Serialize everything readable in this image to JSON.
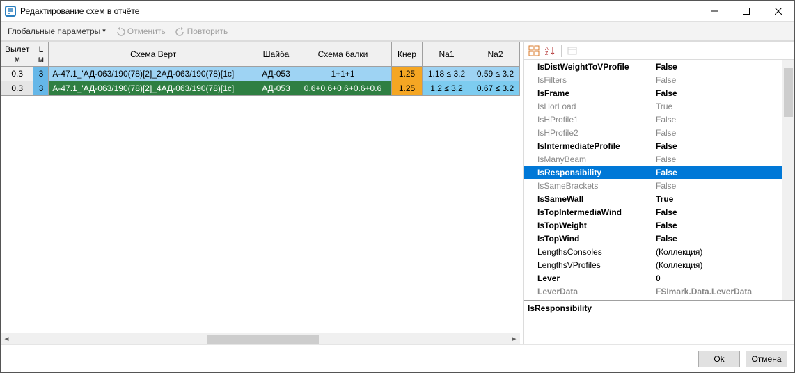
{
  "window": {
    "title": "Редактирование схем в отчёте"
  },
  "toolbar": {
    "global_params": "Глобальные параметры",
    "undo": "Отменить",
    "redo": "Повторить"
  },
  "grid": {
    "headers": {
      "vylet": "Вылет\nм",
      "L": "L\nм",
      "schema_vert": "Схема Верт",
      "shaiba": "Шайба",
      "schema_balki": "Схема балки",
      "kner": "Кнер",
      "na1": "Na1",
      "na2": "Na2"
    },
    "rows": [
      {
        "vylet": "0.3",
        "L": "3",
        "schema_vert": "А-47.1_'АД-063/190(78)[2]_2АД-063/190(78)[1с]",
        "shaiba": "АД-053",
        "schema_balki": "1+1+1",
        "kner": "1.25",
        "na1": "1.18 ≤ 3.2",
        "na2": "0.59 ≤ 3.2"
      },
      {
        "vylet": "0.3",
        "L": "3",
        "schema_vert": "А-47.1_'АД-063/190(78)[2]_4АД-063/190(78)[1с]",
        "shaiba": "АД-053",
        "schema_balki": "0.6+0.6+0.6+0.6+0.6",
        "kner": "1.25",
        "na1": "1.2 ≤ 3.2",
        "na2": "0.67 ≤ 3.2"
      }
    ]
  },
  "properties": [
    {
      "name": "IsDistWeightToVProfile",
      "value": "False",
      "dim": false,
      "bold": true
    },
    {
      "name": "IsFilters",
      "value": "False",
      "dim": true,
      "bold": false
    },
    {
      "name": "IsFrame",
      "value": "False",
      "dim": false,
      "bold": true
    },
    {
      "name": "IsHorLoad",
      "value": "True",
      "dim": true,
      "bold": false
    },
    {
      "name": "IsHProfile1",
      "value": "False",
      "dim": true,
      "bold": false
    },
    {
      "name": "IsHProfile2",
      "value": "False",
      "dim": true,
      "bold": false
    },
    {
      "name": "IsIntermediateProfile",
      "value": "False",
      "dim": false,
      "bold": true
    },
    {
      "name": "IsManyBeam",
      "value": "False",
      "dim": true,
      "bold": false
    },
    {
      "name": "IsResponsibility",
      "value": "False",
      "dim": false,
      "bold": true,
      "selected": true
    },
    {
      "name": "IsSameBrackets",
      "value": "False",
      "dim": true,
      "bold": false
    },
    {
      "name": "IsSameWall",
      "value": "True",
      "dim": false,
      "bold": true
    },
    {
      "name": "IsTopIntermediaWind",
      "value": "False",
      "dim": false,
      "bold": true
    },
    {
      "name": "IsTopWeight",
      "value": "False",
      "dim": false,
      "bold": true
    },
    {
      "name": "IsTopWind",
      "value": "False",
      "dim": false,
      "bold": true
    },
    {
      "name": "LengthsConsoles",
      "value": "(Коллекция)",
      "dim": false,
      "bold": false
    },
    {
      "name": "LengthsVProfiles",
      "value": "(Коллекция)",
      "dim": false,
      "bold": false
    },
    {
      "name": "Lever",
      "value": "0",
      "dim": false,
      "bold": true
    },
    {
      "name": "LeverData",
      "value": "FSImark.Data.LeverData",
      "dim": true,
      "bold": true
    }
  ],
  "desc": {
    "title": "IsResponsibility"
  },
  "footer": {
    "ok": "Ok",
    "cancel": "Отмена"
  }
}
